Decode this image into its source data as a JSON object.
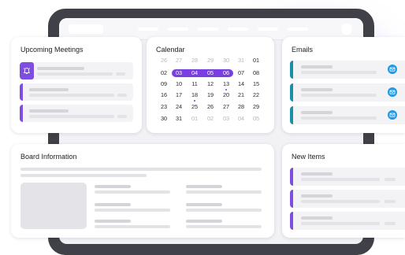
{
  "meetings": {
    "title": "Upcoming Meetings",
    "icons": [
      "alarm-bell-icon"
    ]
  },
  "calendar": {
    "title": "Calendar",
    "weeks": [
      [
        {
          "d": "26",
          "m": true
        },
        {
          "d": "27",
          "m": true
        },
        {
          "d": "28",
          "m": true
        },
        {
          "d": "29",
          "m": true
        },
        {
          "d": "30",
          "m": true
        },
        {
          "d": "31",
          "m": true
        },
        {
          "d": "01"
        }
      ],
      [
        {
          "d": "02"
        },
        {
          "d": "03",
          "s": true
        },
        {
          "d": "04",
          "s": true
        },
        {
          "d": "05",
          "s": true
        },
        {
          "d": "06",
          "s": true
        },
        {
          "d": "07"
        },
        {
          "d": "08"
        }
      ],
      [
        {
          "d": "09"
        },
        {
          "d": "10"
        },
        {
          "d": "11"
        },
        {
          "d": "12"
        },
        {
          "d": "13",
          "dot": true
        },
        {
          "d": "14"
        },
        {
          "d": "15"
        }
      ],
      [
        {
          "d": "16"
        },
        {
          "d": "17"
        },
        {
          "d": "18",
          "dot": true
        },
        {
          "d": "19"
        },
        {
          "d": "20"
        },
        {
          "d": "21"
        },
        {
          "d": "22"
        }
      ],
      [
        {
          "d": "23"
        },
        {
          "d": "24"
        },
        {
          "d": "25"
        },
        {
          "d": "26"
        },
        {
          "d": "27"
        },
        {
          "d": "28"
        },
        {
          "d": "29"
        }
      ],
      [
        {
          "d": "30"
        },
        {
          "d": "31"
        },
        {
          "d": "01",
          "m": true
        },
        {
          "d": "02",
          "m": true
        },
        {
          "d": "03",
          "m": true
        },
        {
          "d": "04",
          "m": true
        },
        {
          "d": "05",
          "m": true
        }
      ]
    ],
    "selection_color": "#7a3fe0"
  },
  "emails": {
    "title": "Emails",
    "icon": "mail-icon",
    "accent_color": "#1990a8",
    "icon_color": "#1e9be8"
  },
  "board": {
    "title": "Board Information"
  },
  "new_items": {
    "title": "New Items",
    "accent_color": "#7d4ee0"
  }
}
